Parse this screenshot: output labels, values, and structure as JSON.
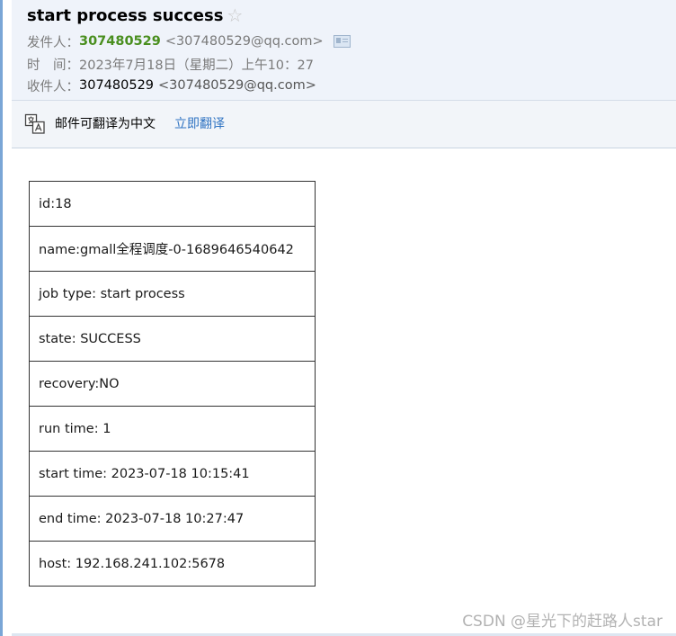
{
  "subject": "start process success",
  "sender": {
    "label": "发件人：",
    "name": "307480529",
    "address": "<307480529@qq.com>"
  },
  "time": {
    "label": "时　间：",
    "value": "2023年7月18日（星期二）上午10：27"
  },
  "recipient": {
    "label": "收件人：",
    "name": "307480529",
    "address": "<307480529@qq.com>"
  },
  "translate": {
    "message": "邮件可翻译为中文",
    "action": "立即翻译"
  },
  "table_rows": [
    "id:18",
    "name:gmall全程调度-0-1689646540642",
    "job type: start process",
    "state: SUCCESS",
    "recovery:NO",
    "run time: 1",
    "start time: 2023-07-18 10:15:41",
    "end time: 2023-07-18 10:27:47",
    "host: 192.168.241.102:5678"
  ],
  "watermark": "CSDN @星光下的赶路人star",
  "icons": {
    "star": "star-outline-icon",
    "contact_card": "contact-card-icon",
    "translate": "translate-icon"
  },
  "colors": {
    "sender_name": "#4a8f1f",
    "link": "#2f73c2",
    "header_bg": "#eff3fa"
  }
}
